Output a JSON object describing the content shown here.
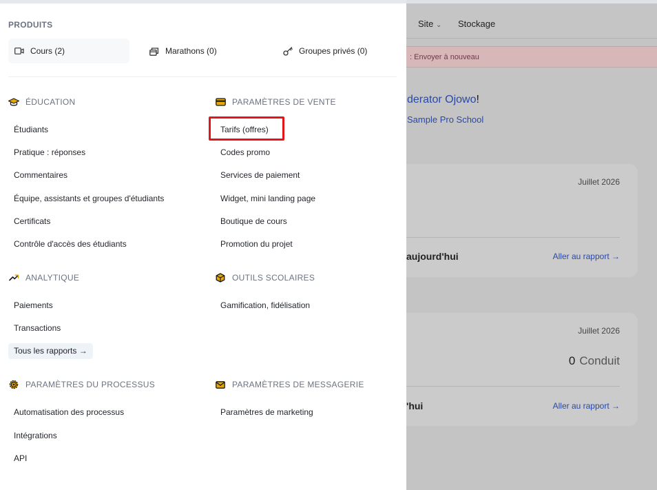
{
  "background": {
    "nav": {
      "site": "Site",
      "site_chevron": "⌄",
      "storage": "Stockage"
    },
    "alert": {
      "text": ": Envoyer à nouveau"
    },
    "welcome": {
      "name": "derator Ojowo",
      "punct": "!"
    },
    "school": "Sample Pro School",
    "cards": [
      {
        "date": "Juillet 2026",
        "label": "aujourd'hui",
        "link": "Aller au rapport →",
        "value": "",
        "unit": ""
      },
      {
        "date": "Juillet 2026",
        "label": "'hui",
        "link": "Aller au rapport →",
        "value": "0",
        "unit": "Conduit"
      }
    ]
  },
  "menu": {
    "products_title": "PRODUITS",
    "products": [
      {
        "label": "Cours (2)",
        "icon": "video-camera-icon"
      },
      {
        "label": "Marathons (0)",
        "icon": "stack-icon"
      },
      {
        "label": "Groupes privés (0)",
        "icon": "key-icon"
      }
    ],
    "education": {
      "title": "ÉDUCATION",
      "icon": "graduation-cap-icon",
      "items": [
        "Étudiants",
        "Pratique : réponses",
        "Commentaires",
        "Équipe, assistants et groupes d'étudiants",
        "Certificats",
        "Contrôle d'accès des étudiants"
      ]
    },
    "sales": {
      "title": "PARAMÈTRES DE VENTE",
      "icon": "credit-card-icon",
      "items": [
        "Tarifs (offres)",
        "Codes promo",
        "Services de paiement",
        "Widget, mini landing page",
        "Boutique de cours",
        "Promotion du projet"
      ]
    },
    "analytics": {
      "title": "ANALYTIQUE",
      "icon": "trend-up-icon",
      "items": [
        "Paiements",
        "Transactions"
      ],
      "all_reports": "Tous les rapports →"
    },
    "tools": {
      "title": "OUTILS SCOLAIRES",
      "icon": "cube-icon",
      "items": [
        "Gamification, fidélisation"
      ]
    },
    "process": {
      "title": "PARAMÈTRES DU PROCESSUS",
      "icon": "gear-icon",
      "items": [
        "Automatisation des processus",
        "Intégrations",
        "API"
      ]
    },
    "messaging": {
      "title": "PARAMÈTRES DE MESSAGERIE",
      "icon": "envelope-icon",
      "items": [
        "Paramètres de marketing"
      ]
    }
  },
  "colors": {
    "accent": "#2948a6",
    "highlight": "#e3141a",
    "icon_yellow": "#e6a800"
  }
}
